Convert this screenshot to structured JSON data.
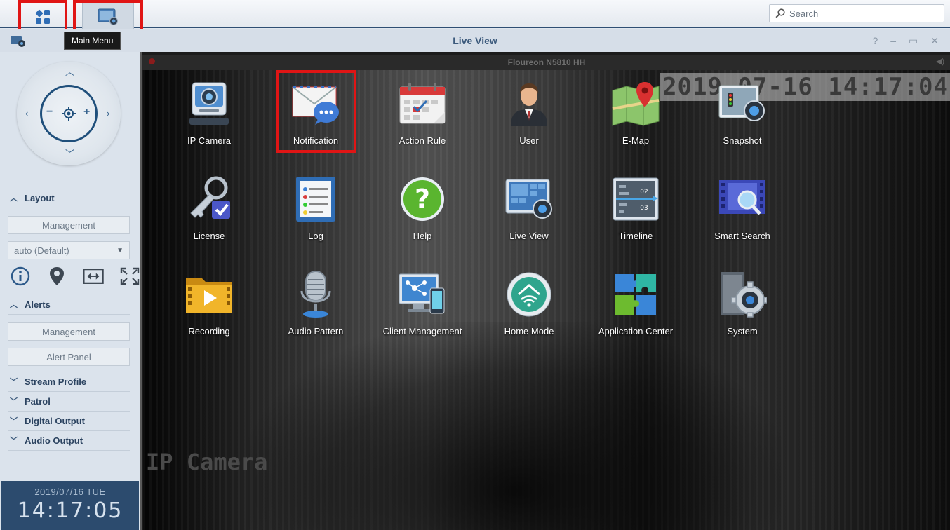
{
  "taskbar": {
    "search_placeholder": "Search",
    "main_menu_icon": "grid-icon",
    "live_view_icon": "live-view-icon"
  },
  "tooltip": "Main Menu",
  "window": {
    "title": "Live View",
    "controls": [
      "?",
      "–",
      "▭",
      "✕"
    ]
  },
  "video": {
    "camera_name": "Floureon N5810 HH",
    "osd_time": "2019-07-16 14:17:04",
    "osd_label": "IP Camera"
  },
  "left_panel": {
    "layout": {
      "title": "Layout",
      "management": "Management",
      "select_value": "auto (Default)"
    },
    "tools": [
      "info-icon",
      "map-pin-icon",
      "fit-width-icon",
      "fullscreen-icon"
    ],
    "alerts": {
      "title": "Alerts",
      "management": "Management",
      "alert_panel": "Alert Panel"
    },
    "collapsed": [
      "Stream Profile",
      "Patrol",
      "Digital Output",
      "Audio Output"
    ],
    "clock": {
      "date": "2019/07/16 TUE",
      "time": "14:17:05"
    }
  },
  "menu": {
    "items": [
      {
        "label": "IP Camera",
        "icon": "ip-camera-icon"
      },
      {
        "label": "Notification",
        "icon": "notification-icon"
      },
      {
        "label": "Action Rule",
        "icon": "calendar-icon"
      },
      {
        "label": "User",
        "icon": "user-icon"
      },
      {
        "label": "E-Map",
        "icon": "map-icon"
      },
      {
        "label": "Snapshot",
        "icon": "snapshot-icon"
      },
      {
        "label": "License",
        "icon": "key-icon"
      },
      {
        "label": "Log",
        "icon": "log-icon"
      },
      {
        "label": "Help",
        "icon": "help-icon"
      },
      {
        "label": "Live View",
        "icon": "live-view-icon"
      },
      {
        "label": "Timeline",
        "icon": "timeline-icon"
      },
      {
        "label": "Smart Search",
        "icon": "smart-search-icon"
      },
      {
        "label": "Recording",
        "icon": "recording-icon"
      },
      {
        "label": "Audio Pattern",
        "icon": "microphone-icon"
      },
      {
        "label": "Client Management",
        "icon": "client-management-icon"
      },
      {
        "label": "Home Mode",
        "icon": "home-mode-icon"
      },
      {
        "label": "Application Center",
        "icon": "puzzle-icon"
      },
      {
        "label": "System",
        "icon": "system-gear-icon"
      }
    ],
    "timeline_numbers": [
      "02",
      "03"
    ]
  },
  "colors": {
    "highlight": "#e01515",
    "accent": "#2e4e73",
    "panel": "#dbe3ec"
  }
}
